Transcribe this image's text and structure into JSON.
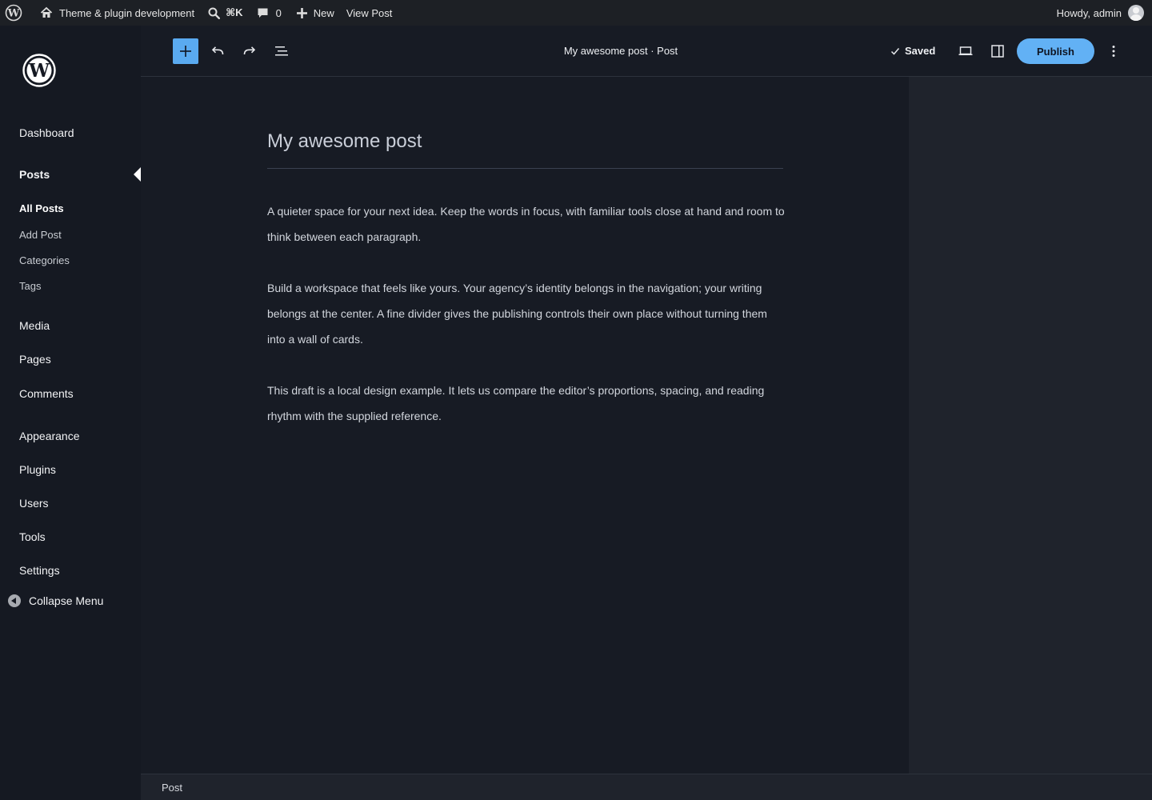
{
  "admin_bar": {
    "site_name": "Theme & plugin development",
    "shortcut": "⌘K",
    "comments_count": "0",
    "new_label": "New",
    "view_post_label": "View Post",
    "howdy": "Howdy, admin"
  },
  "sidebar": {
    "items": {
      "dashboard": "Dashboard",
      "posts": "Posts",
      "all_posts": "All Posts",
      "add_post": "Add Post",
      "categories": "Categories",
      "tags": "Tags",
      "media": "Media",
      "pages": "Pages",
      "comments": "Comments",
      "appearance": "Appearance",
      "plugins": "Plugins",
      "users": "Users",
      "tools": "Tools",
      "settings": "Settings"
    },
    "collapse_label": "Collapse Menu"
  },
  "editor_header": {
    "document_title": "My awesome post · Post",
    "saved_label": "Saved",
    "publish_label": "Publish"
  },
  "post": {
    "title": "My awesome post",
    "paragraphs": [
      "A quieter space for your next idea. Keep the words in focus, with familiar tools close at hand and room to think between each paragraph.",
      "Build a workspace that feels like yours. Your agency’s identity belongs in the navigation; your writing belongs at the center. A fine divider gives the publishing controls their own place without turning them into a wall of cards.",
      "This draft is a local design example. It lets us compare the editor’s proportions, spacing, and reading rhythm with the supplied reference."
    ]
  },
  "footer": {
    "breadcrumb": "Post"
  },
  "colors": {
    "accent": "#62b1f5",
    "canvas_bg": "#171b24",
    "sidebar_bg": "#151922",
    "admin_bar_bg": "#1d2025"
  }
}
